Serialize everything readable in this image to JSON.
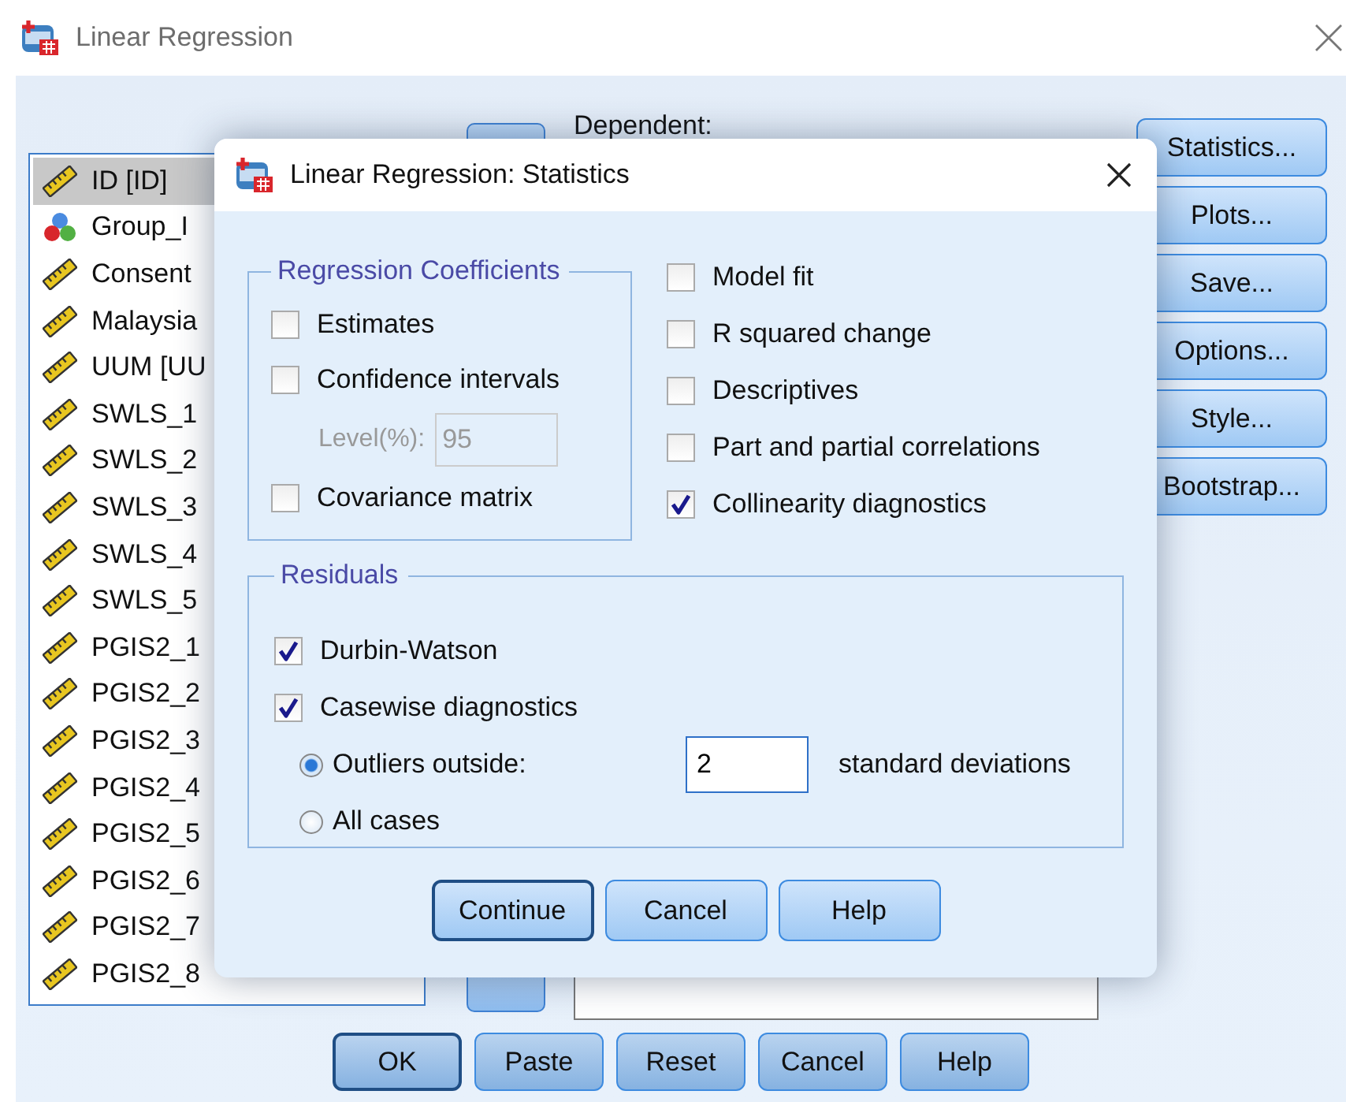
{
  "window": {
    "title": "Linear Regression"
  },
  "variables": [
    {
      "name": "ID [ID]",
      "kind": "scale",
      "selected": true
    },
    {
      "name": "Group_I",
      "kind": "nominal",
      "selected": false
    },
    {
      "name": "Consent",
      "kind": "scale",
      "selected": false
    },
    {
      "name": "Malaysia",
      "kind": "scale",
      "selected": false
    },
    {
      "name": "UUM [UU",
      "kind": "scale",
      "selected": false
    },
    {
      "name": "SWLS_1",
      "kind": "scale",
      "selected": false
    },
    {
      "name": "SWLS_2",
      "kind": "scale",
      "selected": false
    },
    {
      "name": "SWLS_3",
      "kind": "scale",
      "selected": false
    },
    {
      "name": "SWLS_4",
      "kind": "scale",
      "selected": false
    },
    {
      "name": "SWLS_5",
      "kind": "scale",
      "selected": false
    },
    {
      "name": "PGIS2_1",
      "kind": "scale",
      "selected": false
    },
    {
      "name": "PGIS2_2",
      "kind": "scale",
      "selected": false
    },
    {
      "name": "PGIS2_3",
      "kind": "scale",
      "selected": false
    },
    {
      "name": "PGIS2_4",
      "kind": "scale",
      "selected": false
    },
    {
      "name": "PGIS2_5",
      "kind": "scale",
      "selected": false
    },
    {
      "name": "PGIS2_6",
      "kind": "scale",
      "selected": false
    },
    {
      "name": "PGIS2_7",
      "kind": "scale",
      "selected": false
    },
    {
      "name": "PGIS2_8",
      "kind": "scale",
      "selected": false
    }
  ],
  "dependent_label": "Dependent:",
  "side_buttons": [
    {
      "label": "Statistics..."
    },
    {
      "label": "Plots..."
    },
    {
      "label": "Save..."
    },
    {
      "label": "Options..."
    },
    {
      "label": "Style..."
    },
    {
      "label": "Bootstrap..."
    }
  ],
  "bottom_buttons": [
    {
      "label": "OK",
      "default": true
    },
    {
      "label": "Paste",
      "default": false
    },
    {
      "label": "Reset",
      "default": false
    },
    {
      "label": "Cancel",
      "default": false
    },
    {
      "label": "Help",
      "default": false
    }
  ],
  "dialog": {
    "title": "Linear Regression: Statistics",
    "coefficients": {
      "title": "Regression Coefficients",
      "options": [
        {
          "label": "Estimates",
          "checked": false
        },
        {
          "label": "Confidence intervals",
          "checked": false
        },
        {
          "label": "Covariance matrix",
          "checked": false
        }
      ],
      "level": {
        "label": "Level(%):",
        "value": "95",
        "disabled": true
      }
    },
    "options": [
      {
        "label": "Model fit",
        "checked": false
      },
      {
        "label": "R squared change",
        "checked": false
      },
      {
        "label": "Descriptives",
        "checked": false
      },
      {
        "label": "Part and partial correlations",
        "checked": false
      },
      {
        "label": "Collinearity diagnostics",
        "checked": true
      }
    ],
    "residuals": {
      "title": "Residuals",
      "options": [
        {
          "label": "Durbin-Watson",
          "checked": true
        },
        {
          "label": "Casewise diagnostics",
          "checked": true
        }
      ],
      "radios": [
        {
          "label": "Outliers outside:",
          "selected": true
        },
        {
          "label": "All cases",
          "selected": false
        }
      ],
      "outlier_value": "2",
      "outlier_suffix": "standard deviations"
    },
    "buttons": [
      {
        "label": "Continue",
        "default": true
      },
      {
        "label": "Cancel",
        "default": false
      },
      {
        "label": "Help",
        "default": false
      }
    ]
  }
}
